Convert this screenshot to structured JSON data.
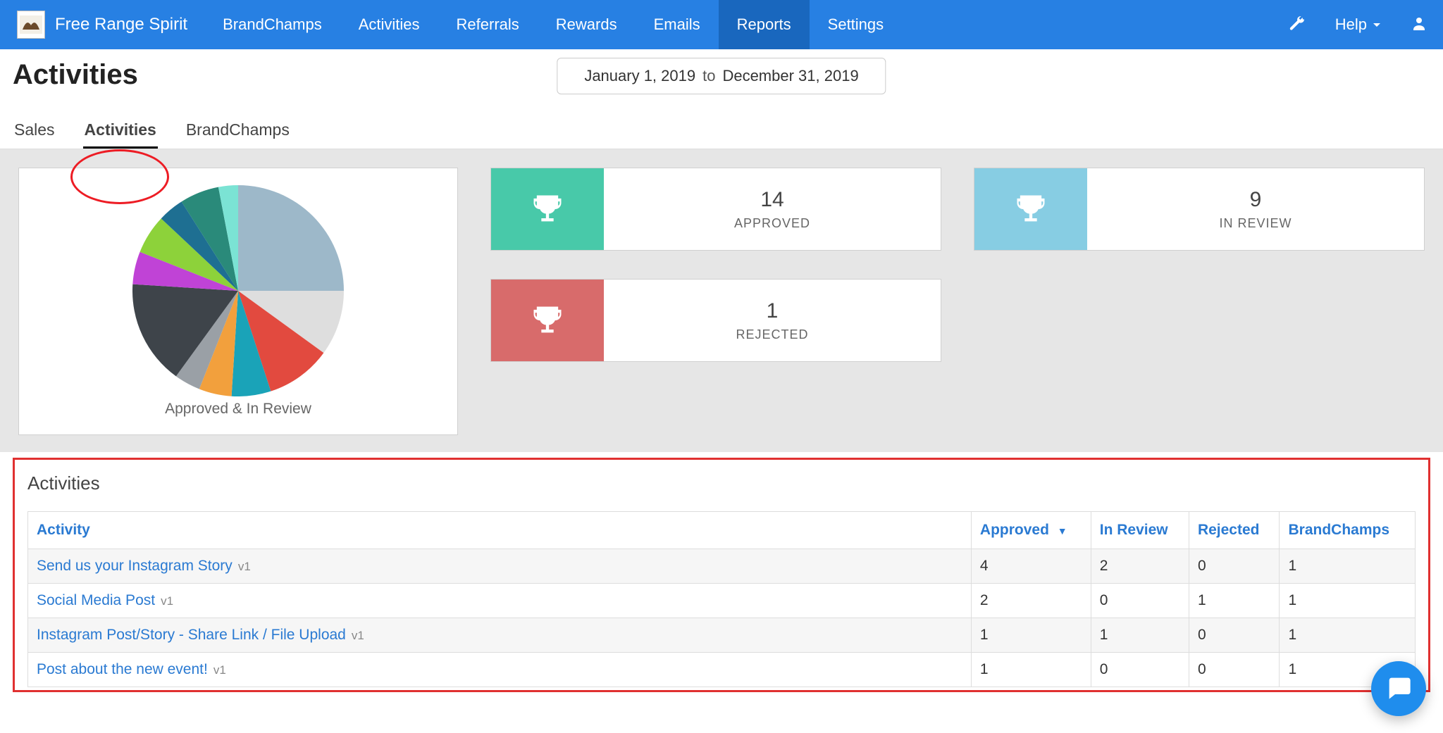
{
  "nav": {
    "brand": "Free Range Spirit",
    "items": [
      {
        "label": "BrandChamps",
        "active": false
      },
      {
        "label": "Activities",
        "active": false
      },
      {
        "label": "Referrals",
        "active": false
      },
      {
        "label": "Rewards",
        "active": false
      },
      {
        "label": "Emails",
        "active": false
      },
      {
        "label": "Reports",
        "active": true
      },
      {
        "label": "Settings",
        "active": false
      }
    ],
    "help": "Help"
  },
  "header": {
    "title": "Activities",
    "date_from": "January 1, 2019",
    "date_to_word": "to",
    "date_to": "December 31, 2019",
    "tabs": [
      {
        "label": "Sales",
        "active": false
      },
      {
        "label": "Activities",
        "active": true
      },
      {
        "label": "BrandChamps",
        "active": false
      }
    ]
  },
  "chart_data": {
    "type": "pie",
    "title": "Approved & In Review",
    "slices": [
      {
        "name": "slice-1",
        "value": 25,
        "color": "#9db8c9"
      },
      {
        "name": "slice-2",
        "value": 10,
        "color": "#dedede"
      },
      {
        "name": "slice-3",
        "value": 10,
        "color": "#e24a3f"
      },
      {
        "name": "slice-4",
        "value": 6,
        "color": "#1aa3b8"
      },
      {
        "name": "slice-5",
        "value": 5,
        "color": "#f2a03d"
      },
      {
        "name": "slice-6",
        "value": 4,
        "color": "#9aa0a6"
      },
      {
        "name": "slice-7",
        "value": 16,
        "color": "#3e444a"
      },
      {
        "name": "slice-8",
        "value": 5,
        "color": "#c043d6"
      },
      {
        "name": "slice-9",
        "value": 6,
        "color": "#8dd23a"
      },
      {
        "name": "slice-10",
        "value": 4,
        "color": "#1e6f92"
      },
      {
        "name": "slice-11",
        "value": 6,
        "color": "#2a8a7a"
      },
      {
        "name": "slice-12",
        "value": 3,
        "color": "#7be3d4"
      }
    ]
  },
  "stats": {
    "approved": {
      "value": "14",
      "label": "APPROVED",
      "color": "green"
    },
    "rejected": {
      "value": "1",
      "label": "REJECTED",
      "color": "red"
    },
    "in_review": {
      "value": "9",
      "label": "IN REVIEW",
      "color": "blue"
    }
  },
  "table": {
    "title": "Activities",
    "columns": [
      {
        "label": "Activity",
        "sort": false
      },
      {
        "label": "Approved",
        "sort": true
      },
      {
        "label": "In Review",
        "sort": false
      },
      {
        "label": "Rejected",
        "sort": false
      },
      {
        "label": "BrandChamps",
        "sort": false
      }
    ],
    "rows": [
      {
        "name": "Send us your Instagram Story",
        "ver": "v1",
        "approved": "4",
        "in_review": "2",
        "rejected": "0",
        "bc": "1"
      },
      {
        "name": "Social Media Post",
        "ver": "v1",
        "approved": "2",
        "in_review": "0",
        "rejected": "1",
        "bc": "1"
      },
      {
        "name": "Instagram Post/Story - Share Link / File Upload",
        "ver": "v1",
        "approved": "1",
        "in_review": "1",
        "rejected": "0",
        "bc": "1"
      },
      {
        "name": "Post about the new event!",
        "ver": "v1",
        "approved": "1",
        "in_review": "0",
        "rejected": "0",
        "bc": "1"
      }
    ]
  }
}
